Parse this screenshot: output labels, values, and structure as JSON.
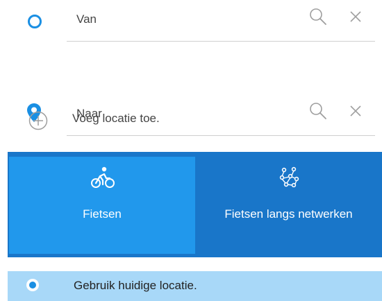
{
  "route": {
    "from": {
      "placeholder": "Van",
      "value": ""
    },
    "to": {
      "placeholder": "Naar",
      "value": ""
    },
    "add_location_label": "Voeg locatie toe."
  },
  "modes": [
    {
      "label": "Fietsen",
      "icon": "bicycle-icon",
      "selected": true
    },
    {
      "label": "Fietsen langs netwerken",
      "icon": "network-route-icon",
      "selected": false
    }
  ],
  "current_location_label": "Gebruik huidige locatie.",
  "colors": {
    "accent": "#1a8fe3",
    "mode_bar": "#1976c9",
    "mode_selected": "#2198ec",
    "location_row": "#a8d8f8"
  }
}
